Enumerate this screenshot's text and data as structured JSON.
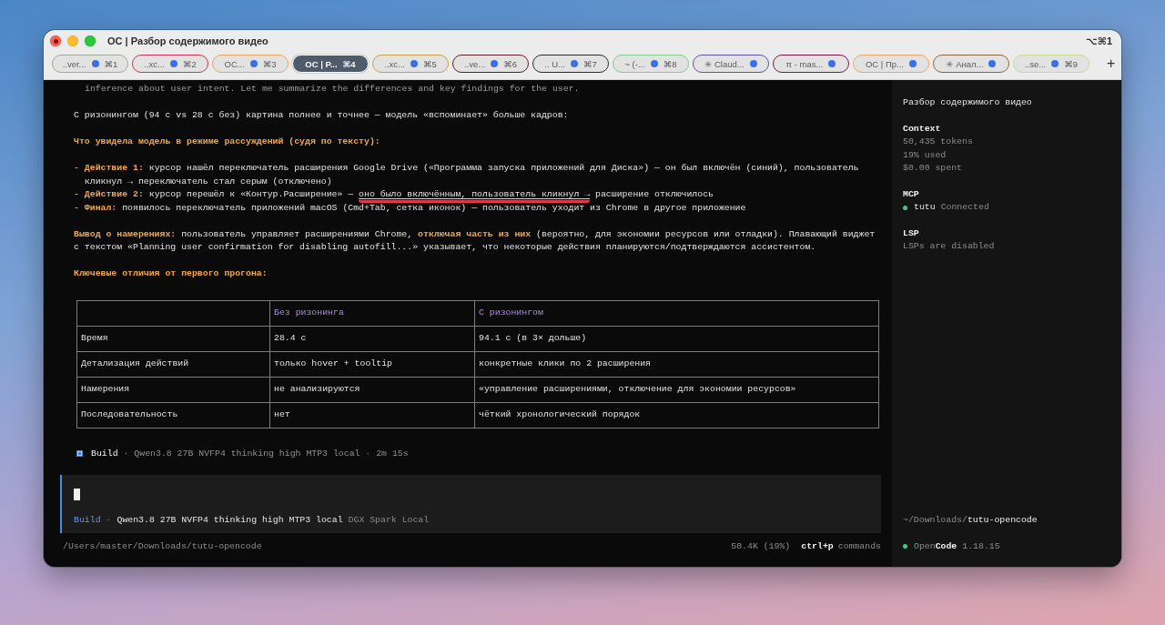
{
  "window": {
    "title": "OC | Разбор содержимого видео",
    "shortcut": "⌥⌘1"
  },
  "tabs": [
    {
      "label": "..ver...",
      "shortcut": "⌘1",
      "color": "#9eaa98",
      "activity": true,
      "selected": false
    },
    {
      "label": "..xc...",
      "shortcut": "⌘2",
      "color": "#c8384e",
      "activity": true,
      "selected": false
    },
    {
      "label": "OC...",
      "shortcut": "⌘3",
      "color": "#eca45c",
      "activity": true,
      "selected": false
    },
    {
      "label": "OC | P...",
      "shortcut": "⌘4",
      "color": "#4d5b6b",
      "activity": false,
      "selected": true
    },
    {
      "label": "..xc...",
      "shortcut": "⌘5",
      "color": "#c9a23f",
      "activity": true,
      "selected": false
    },
    {
      "label": "..ve...",
      "shortcut": "⌘6",
      "color": "#5e1f1f",
      "activity": true,
      "selected": false
    },
    {
      "label": ".. U...",
      "shortcut": "⌘7",
      "color": "#2b2b2b",
      "activity": true,
      "selected": false
    },
    {
      "label": "~ (-...",
      "shortcut": "⌘8",
      "color": "#7ccf8e",
      "activity": true,
      "selected": false
    },
    {
      "label": "✳ Claud...",
      "color": "#5e54a8",
      "activity": true,
      "selected": false
    },
    {
      "label": "π - mas...",
      "color": "#7a1848",
      "activity": true,
      "selected": false
    },
    {
      "label": "OC | Пр...",
      "color": "#f0a466",
      "activity": true,
      "selected": false
    },
    {
      "label": "✳ Анал...",
      "color": "#86683e",
      "activity": true,
      "selected": false
    },
    {
      "label": "..se...",
      "shortcut": "⌘9",
      "color": "#c9dc8e",
      "activity": true,
      "selected": false
    }
  ],
  "new_tab": {
    "label": "+"
  },
  "conversation": {
    "thinking": "inference about user intent. Let me summarize the differences and key findings for the user.",
    "blocks": [
      {
        "kind": "paragraph",
        "text": "С ризонингом (94 с vs 28 с без) картина полнее и точнее — модель «вспоминает» больше кадров:"
      },
      {
        "kind": "heading",
        "text": "Что увидела модель в режиме рассуждений (судя по тексту):"
      },
      {
        "kind": "list",
        "items": [
          {
            "segments": [
              {
                "text": "- **Действие 1:** курсор нашёл переключатель расширения Google Drive («Программа запуска приложений для Диска») — он был включён (синий), пользователь кликнул → переключатель стал серым (отключено)",
                "underlined": false
              }
            ]
          },
          {
            "segments": [
              {
                "text": "- **Действие 2:** курсор перешёл к «Контур.Расширение» — ",
                "underlined": false
              },
              {
                "text": "оно было включённым, пользователь кликнул →",
                "underlined": true
              },
              {
                "text": " расширение отключилось",
                "underlined": false
              }
            ]
          },
          {
            "segments": [
              {
                "text": "- **Финал:** появилось переключатель приложений macOS (Cmd+Tab, сетка иконок) — пользователь уходит из Chrome в другое приложение",
                "underlined": false
              }
            ]
          }
        ]
      },
      {
        "kind": "paragraph",
        "text": "**Вывод о намерениях:** пользователь управляет расширениями Chrome, **отключая часть из них** (вероятно, для экономии ресурсов или отладки). Плавающий виджет с текстом «Planning user confirmation for disabling autofill...» указывает, что некоторые действия планируются/подтверждаются ассистентом."
      },
      {
        "kind": "heading",
        "text": "Ключевые отличия от первого прогона:"
      },
      {
        "kind": "table",
        "columns": [
          "Без ризонинга",
          "С ризонингом"
        ],
        "rows": [
          {
            "label": "Время",
            "cells": [
              "28.4 с",
              "94.1 с (в 3× дольше)"
            ]
          },
          {
            "label": "Детализация действий",
            "cells": [
              "только hover + tooltip",
              "конкретные клики по 2 расширения"
            ]
          },
          {
            "label": "Намерения",
            "cells": [
              "не анализируются",
              "«управление расширениями, отключение для экономии ресурсов»"
            ]
          },
          {
            "label": "Последовательность",
            "cells": [
              "нет",
              "чёткий хронологический порядок"
            ]
          }
        ]
      },
      {
        "kind": "status",
        "agent": "Build",
        "details": "· Qwen3.8 27B NVFP4 thinking high MTP3 local · 2m 15s"
      }
    ]
  },
  "prompt": {
    "agent": "Build",
    "separator": "·",
    "model": "Qwen3.8 27B NVFP4 thinking high MTP3 local",
    "provider": "DGX Spark Local"
  },
  "footer": {
    "path": "/Users/master/Downloads/tutu-opencode",
    "usage": "50.4K (19%)",
    "shortcut_key": "ctrl+p",
    "shortcut_label": "commands"
  },
  "sidebar": {
    "title": "Разбор содержимого видео",
    "context": {
      "heading": "Context",
      "lines": [
        "50,435 tokens",
        "19% used",
        "$0.00 spent"
      ]
    },
    "mcp": {
      "heading": "MCP",
      "servers": [
        {
          "name": "tutu",
          "status": "Connected",
          "connected": true
        }
      ]
    },
    "lsp": {
      "heading": "LSP",
      "status": "LSPs are disabled"
    },
    "directory": "~/Downloads/**tutu-opencode**",
    "app": {
      "name": "Open**Code**",
      "version": "1.18.15"
    }
  }
}
